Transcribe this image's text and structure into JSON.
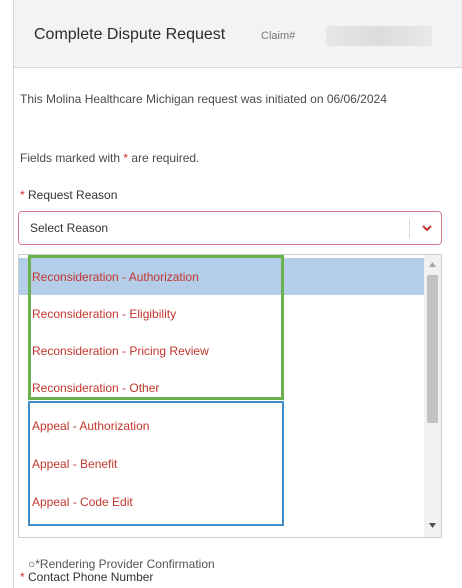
{
  "header": {
    "title": "Complete Dispute Request",
    "claim_label": "Claim#"
  },
  "intro_text": "This Molina Healthcare Michigan request was initiated on 06/06/2024",
  "fields_note": {
    "prefix": "Fields marked with",
    "asterisk": "*",
    "suffix": "are required."
  },
  "request_reason": {
    "asterisk": "*",
    "label": "Request Reason",
    "placeholder": "Select Reason"
  },
  "dropdown": {
    "options": [
      "Reconsideration - Authorization",
      "Reconsideration - Eligibility",
      "Reconsideration - Pricing Review",
      "Reconsideration - Other",
      "Appeal - Authorization",
      "Appeal - Benefit",
      "Appeal - Code Edit"
    ],
    "highlighted_option": "Reconsideration - Authorization"
  },
  "partially_hidden_label": "○*Rendering Provider Confirmation",
  "contact_phone": {
    "asterisk": "*",
    "label": "Contact Phone Number"
  },
  "colors": {
    "error_border": "#d87b87",
    "option_text": "#c0362c",
    "highlight_bg": "#b4cde9",
    "green_box": "#6ab04c",
    "blue_box": "#3e8fcd"
  }
}
